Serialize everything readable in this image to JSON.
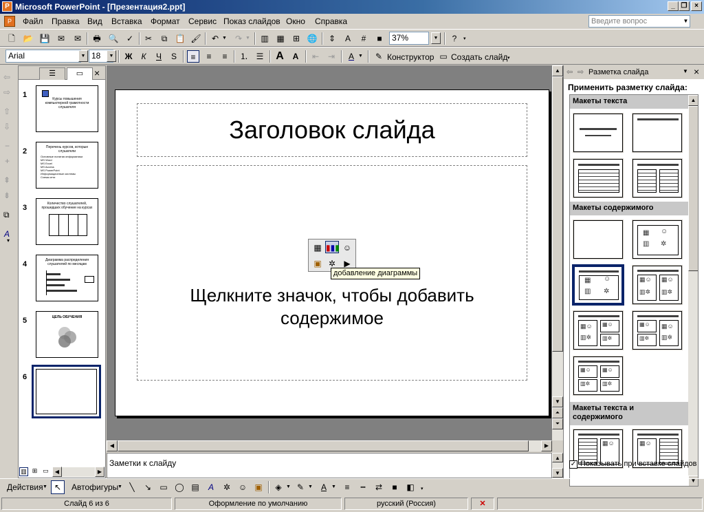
{
  "window": {
    "title": "Microsoft PowerPoint - [Презентация2.ppt]",
    "app_icon": "powerpoint-icon"
  },
  "menu": [
    "Файл",
    "Правка",
    "Вид",
    "Вставка",
    "Формат",
    "Сервис",
    "Показ слайдов",
    "Окно",
    "Справка"
  ],
  "help_search": {
    "placeholder": "Введите вопрос"
  },
  "standard_toolbar": {
    "zoom": "37%"
  },
  "formatting_toolbar": {
    "font": "Arial",
    "size": "18",
    "designer_label": "Конструктор",
    "new_slide_label": "Создать слайд"
  },
  "slides": [
    {
      "num": "1",
      "title": "Курсы повышения компьютерной грамотности слушателя"
    },
    {
      "num": "2",
      "title": "Перечень курсов, которые слушатели",
      "bullets": [
        "Основные понятия информатики",
        "MS Word",
        "MS Excel",
        "MS Access",
        "MS PowerPoint",
        "Информационные системы",
        "Схема сети"
      ]
    },
    {
      "num": "3",
      "title": "Количество слушателей, прошедших обучение на курсах"
    },
    {
      "num": "4",
      "title": "Диаграмма распределения слушателей по месяцам"
    },
    {
      "num": "5",
      "title": "ЦЕЛЬ ОБУЧЕНИЯ"
    },
    {
      "num": "6",
      "title": ""
    }
  ],
  "current_slide": {
    "title_placeholder": "Заголовок слайда",
    "body_placeholder": "Щелкните значок, чтобы добавить\nсодержимое"
  },
  "tooltip": "добавление диаграммы",
  "notes": {
    "placeholder": "Заметки к слайду"
  },
  "task_pane": {
    "title": "Разметка слайда",
    "apply_label": "Применить разметку слайда:",
    "sections": [
      "Макеты текста",
      "Макеты содержимого",
      "Макеты текста и\nсодержимого"
    ],
    "show_on_insert_label": "Показывать при вставке слайдов",
    "show_on_insert_checked": true
  },
  "drawing_toolbar": {
    "actions_label": "Действия",
    "autoshapes_label": "Автофигуры"
  },
  "status": {
    "slide_counter": "Слайд 6 из 6",
    "design": "Оформление по умолчанию",
    "language": "русский (Россия)"
  },
  "colors": {
    "title_gradient_start": "#0a246a",
    "selection": "#0a246a",
    "chrome": "#d4d0c8"
  }
}
